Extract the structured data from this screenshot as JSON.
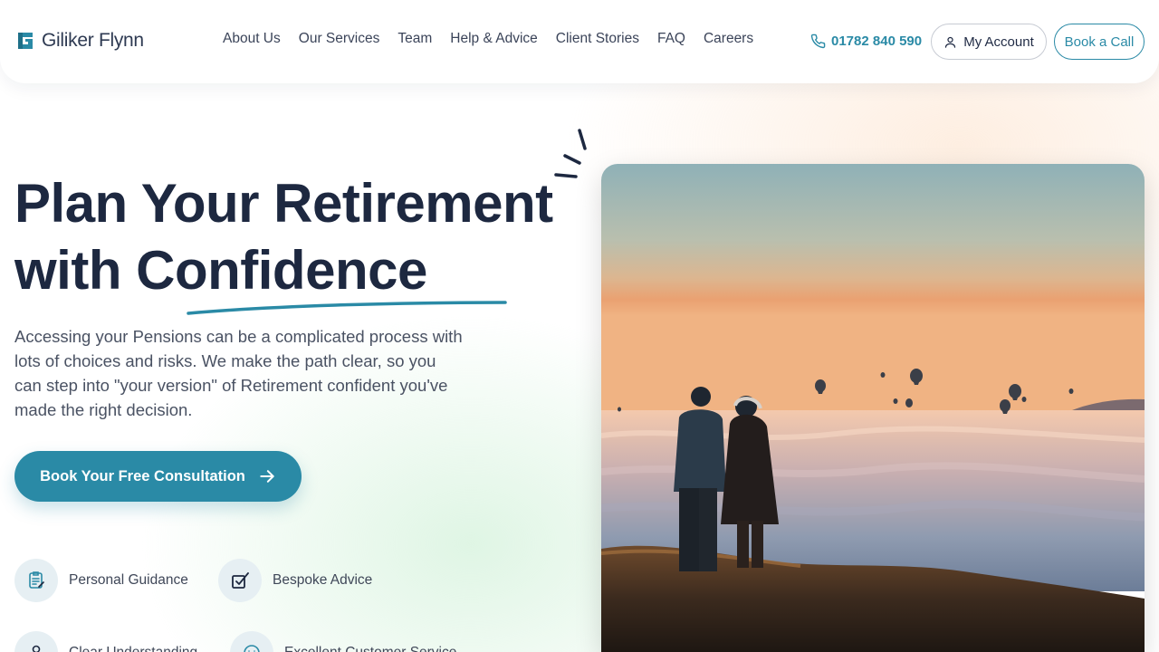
{
  "brand": {
    "name": "Giliker Flynn"
  },
  "nav": {
    "items": [
      "About Us",
      "Our Services",
      "Team",
      "Help & Advice",
      "Client Stories",
      "FAQ",
      "Careers"
    ]
  },
  "header": {
    "phone": "01782 840 590",
    "account_label": "My Account",
    "call_label": "Book a Call"
  },
  "hero": {
    "headline_line1": "Plan Your Retirement",
    "headline_line2": "with Confidence",
    "intro": "Accessing your Pensions can be a complicated process with lots of choices and risks. We make the path clear, so you can step into \"your version\" of Retirement confident you've made the right decision.",
    "cta_label": "Book Your Free Consultation"
  },
  "features": [
    {
      "label": "Personal Guidance",
      "icon": "checklist-icon"
    },
    {
      "label": "Bespoke Advice",
      "icon": "checkbox-tick-icon"
    },
    {
      "label": "Clear Understanding",
      "icon": "person-icon"
    },
    {
      "label": "Excellent Customer Service",
      "icon": "smile-icon"
    }
  ],
  "colors": {
    "accent": "#2a8aa6",
    "heading": "#1d2840",
    "body_text": "#4a5263"
  }
}
